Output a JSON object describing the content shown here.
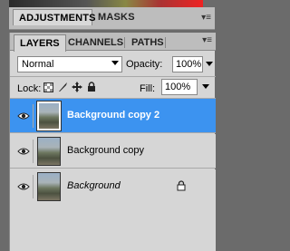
{
  "top_tabs": [
    {
      "label": "ADJUSTMENTS"
    },
    {
      "label": "MASKS"
    }
  ],
  "panel_tabs": [
    {
      "label": "LAYERS"
    },
    {
      "label": "CHANNELS"
    },
    {
      "label": "PATHS"
    }
  ],
  "blend_mode": "Normal",
  "opacity_label": "Opacity:",
  "opacity_value": "100%",
  "lock_label": "Lock:",
  "fill_label": "Fill:",
  "fill_value": "100%",
  "layers": [
    {
      "name": "Background copy 2"
    },
    {
      "name": "Background copy"
    },
    {
      "name": "Background"
    }
  ],
  "colors": {
    "selection": "#3c93f0",
    "panel": "#d6d6d6"
  }
}
